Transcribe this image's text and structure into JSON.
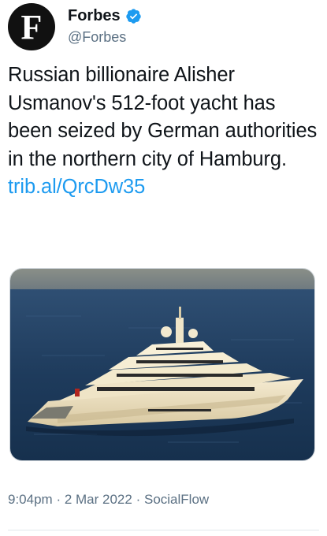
{
  "account": {
    "avatar_letter": "F",
    "display_name": "Forbes",
    "handle": "@Forbes",
    "verified": true
  },
  "tweet": {
    "text": "Russian billionaire Alisher Usmanov's 512-foot yacht has been seized by German authorities in the northern city of Hamburg.",
    "link": "trib.al/QrcDw35"
  },
  "media": {
    "icon": "yacht-photo"
  },
  "meta": {
    "time": "9:04pm",
    "date": "2 Mar 2022",
    "source": "SocialFlow",
    "separator": "·"
  },
  "colors": {
    "link": "#1d9bf0",
    "verified": "#1d9bf0",
    "secondary_text": "#5b7083"
  }
}
